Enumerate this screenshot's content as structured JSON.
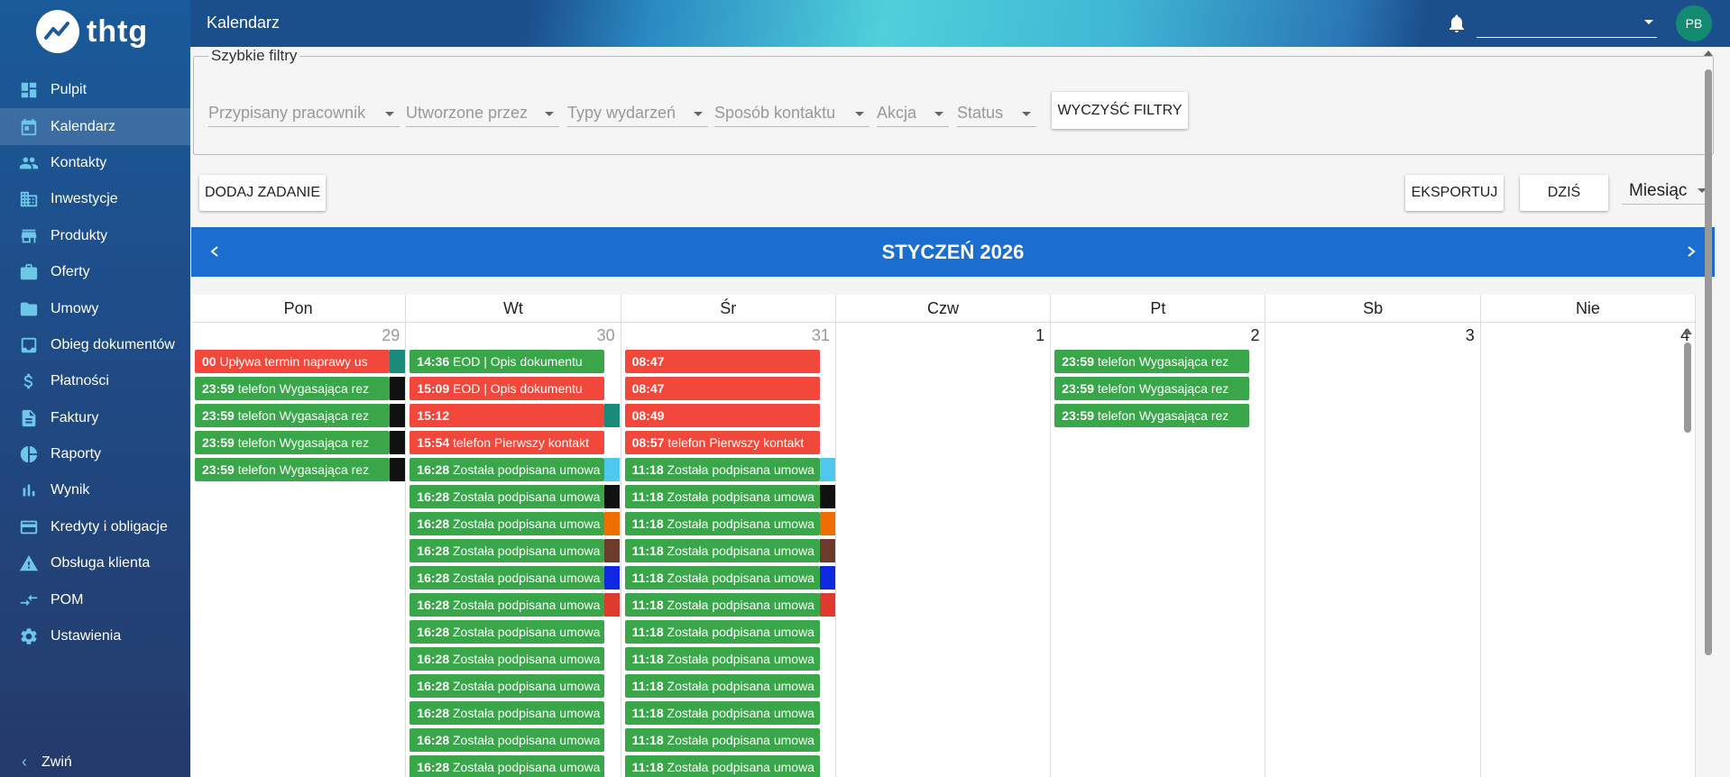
{
  "app": {
    "logo_text": "thtg"
  },
  "sidebar": {
    "items": [
      {
        "label": "Pulpit",
        "icon": "dashboard-icon"
      },
      {
        "label": "Kalendarz",
        "icon": "calendar-icon",
        "active": true
      },
      {
        "label": "Kontakty",
        "icon": "people-icon"
      },
      {
        "label": "Inwestycje",
        "icon": "building-icon"
      },
      {
        "label": "Produkty",
        "icon": "store-icon"
      },
      {
        "label": "Oferty",
        "icon": "briefcase-icon"
      },
      {
        "label": "Umowy",
        "icon": "folder-icon"
      },
      {
        "label": "Obieg dokumentów",
        "icon": "inbox-icon"
      },
      {
        "label": "Płatności",
        "icon": "dollar-icon"
      },
      {
        "label": "Faktury",
        "icon": "document-icon"
      },
      {
        "label": "Raporty",
        "icon": "pie-chart-icon"
      },
      {
        "label": "Wynik",
        "icon": "bar-chart-icon"
      },
      {
        "label": "Kredyty i obligacje",
        "icon": "credit-card-icon"
      },
      {
        "label": "Obsługa klienta",
        "icon": "warning-icon"
      },
      {
        "label": "POM",
        "icon": "arrows-icon"
      },
      {
        "label": "Ustawienia",
        "icon": "gear-icon"
      }
    ],
    "collapse_label": "Zwiń"
  },
  "header": {
    "title": "Kalendarz",
    "user_initials": "PB",
    "user_select_value": ""
  },
  "filters": {
    "legend": "Szybkie filtry",
    "selects": [
      "Przypisany pracownik",
      "Utworzone przez",
      "Typy wydarzeń",
      "Sposób kontaktu",
      "Akcja",
      "Status"
    ],
    "clear_label": "WYCZYŚĆ FILTRY"
  },
  "toolbar": {
    "add_task_label": "DODAJ ZADANIE",
    "export_label": "EKSPORTUJ",
    "today_label": "DZIŚ",
    "view_value": "Miesiąc"
  },
  "calendar": {
    "month_title": "STYCZEŃ 2026",
    "weekdays": [
      "Pon",
      "Wt",
      "Śr",
      "Czw",
      "Pt",
      "Sb",
      "Nie"
    ],
    "days": [
      {
        "num": "29",
        "other": true,
        "events": [
          {
            "time": "00",
            "text": "Upływa termin naprawy us",
            "color": "red",
            "tag": "#1a8a7a"
          },
          {
            "time": "23:59",
            "text": "telefon Wygasająca rez",
            "color": "green",
            "tag": "#111111"
          },
          {
            "time": "23:59",
            "text": "telefon Wygasająca rez",
            "color": "green",
            "tag": "#111111"
          },
          {
            "time": "23:59",
            "text": "telefon Wygasająca rez",
            "color": "green",
            "tag": "#111111"
          },
          {
            "time": "23:59",
            "text": "telefon Wygasająca rez",
            "color": "green",
            "tag": "#111111"
          }
        ]
      },
      {
        "num": "30",
        "other": true,
        "events": [
          {
            "time": "14:36",
            "text": "EOD | Opis dokumentu",
            "color": "green",
            "tag": ""
          },
          {
            "time": "15:09",
            "text": "EOD | Opis dokumentu",
            "color": "red",
            "tag": ""
          },
          {
            "time": "15:12",
            "text": "",
            "color": "red",
            "tag": "#1a8a7a"
          },
          {
            "time": "15:54",
            "text": "telefon Pierwszy kontakt",
            "color": "red",
            "tag": ""
          },
          {
            "time": "16:28",
            "text": "Została podpisana umowa",
            "color": "green",
            "tag": "#4fc8ef"
          },
          {
            "time": "16:28",
            "text": "Została podpisana umowa",
            "color": "green",
            "tag": "#111111"
          },
          {
            "time": "16:28",
            "text": "Została podpisana umowa",
            "color": "green",
            "tag": "#ef6c00"
          },
          {
            "time": "16:28",
            "text": "Została podpisana umowa",
            "color": "green",
            "tag": "#6d3a2e"
          },
          {
            "time": "16:28",
            "text": "Została podpisana umowa",
            "color": "green",
            "tag": "#1028e0"
          },
          {
            "time": "16:28",
            "text": "Została podpisana umowa",
            "color": "green",
            "tag": "#e03a2e"
          },
          {
            "time": "16:28",
            "text": "Została podpisana umowa",
            "color": "green",
            "tag": ""
          },
          {
            "time": "16:28",
            "text": "Została podpisana umowa",
            "color": "green",
            "tag": ""
          },
          {
            "time": "16:28",
            "text": "Została podpisana umowa",
            "color": "green",
            "tag": ""
          },
          {
            "time": "16:28",
            "text": "Została podpisana umowa",
            "color": "green",
            "tag": ""
          },
          {
            "time": "16:28",
            "text": "Została podpisana umowa",
            "color": "green",
            "tag": ""
          },
          {
            "time": "16:28",
            "text": "Została podpisana umowa",
            "color": "green",
            "tag": ""
          }
        ]
      },
      {
        "num": "31",
        "other": true,
        "events": [
          {
            "time": "08:47",
            "text": "",
            "color": "red",
            "tag": ""
          },
          {
            "time": "08:47",
            "text": "",
            "color": "red",
            "tag": ""
          },
          {
            "time": "08:49",
            "text": "",
            "color": "red",
            "tag": ""
          },
          {
            "time": "08:57",
            "text": "telefon Pierwszy kontakt",
            "color": "red",
            "tag": ""
          },
          {
            "time": "11:18",
            "text": "Została podpisana umowa",
            "color": "green",
            "tag": "#4fc8ef"
          },
          {
            "time": "11:18",
            "text": "Została podpisana umowa",
            "color": "green",
            "tag": "#111111"
          },
          {
            "time": "11:18",
            "text": "Została podpisana umowa",
            "color": "green",
            "tag": "#ef6c00"
          },
          {
            "time": "11:18",
            "text": "Została podpisana umowa",
            "color": "green",
            "tag": "#6d3a2e"
          },
          {
            "time": "11:18",
            "text": "Została podpisana umowa",
            "color": "green",
            "tag": "#1028e0"
          },
          {
            "time": "11:18",
            "text": "Została podpisana umowa",
            "color": "green",
            "tag": "#e03a2e"
          },
          {
            "time": "11:18",
            "text": "Została podpisana umowa",
            "color": "green",
            "tag": ""
          },
          {
            "time": "11:18",
            "text": "Została podpisana umowa",
            "color": "green",
            "tag": ""
          },
          {
            "time": "11:18",
            "text": "Została podpisana umowa",
            "color": "green",
            "tag": ""
          },
          {
            "time": "11:18",
            "text": "Została podpisana umowa",
            "color": "green",
            "tag": ""
          },
          {
            "time": "11:18",
            "text": "Została podpisana umowa",
            "color": "green",
            "tag": ""
          },
          {
            "time": "11:18",
            "text": "Została podpisana umowa",
            "color": "green",
            "tag": ""
          }
        ]
      },
      {
        "num": "1",
        "other": false,
        "events": []
      },
      {
        "num": "2",
        "other": false,
        "events": [
          {
            "time": "23:59",
            "text": "telefon Wygasająca rez",
            "color": "green",
            "tag": ""
          },
          {
            "time": "23:59",
            "text": "telefon Wygasająca rez",
            "color": "green",
            "tag": ""
          },
          {
            "time": "23:59",
            "text": "telefon Wygasająca rez",
            "color": "green",
            "tag": ""
          }
        ]
      },
      {
        "num": "3",
        "other": false,
        "events": []
      },
      {
        "num": "4",
        "other": false,
        "events": []
      }
    ]
  },
  "colors": {
    "green": "#3aa64a",
    "red": "#f2473b",
    "header_blue": "#1a6ed0"
  }
}
